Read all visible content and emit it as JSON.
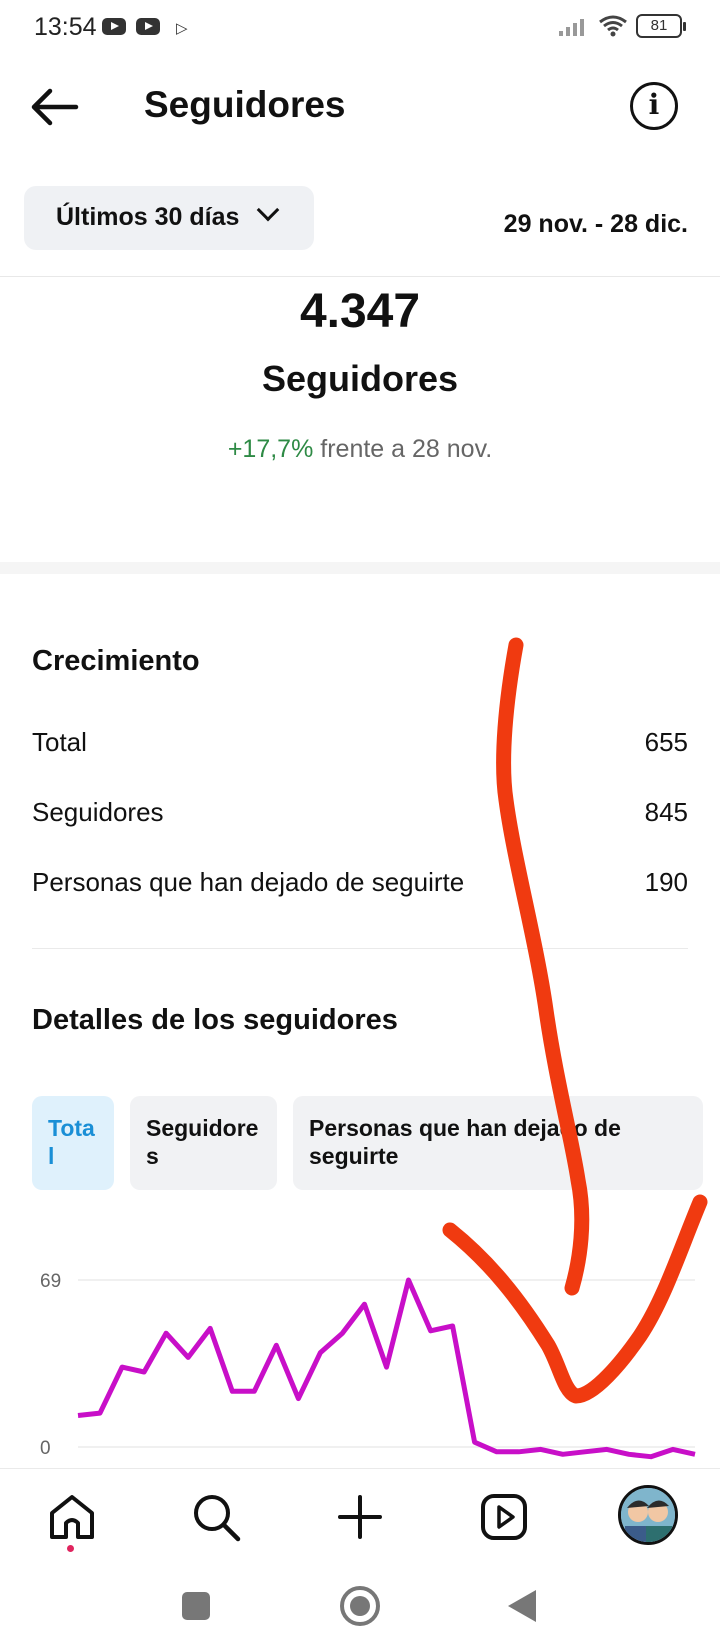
{
  "status_bar": {
    "time": "13:54",
    "battery": "81"
  },
  "header": {
    "title": "Seguidores"
  },
  "period": {
    "selected": "Últimos 30 días",
    "date_range": "29 nov. - 28 dic."
  },
  "summary": {
    "count": "4.347",
    "label": "Seguidores",
    "change_pct": "+17,7%",
    "change_text": "frente a 28 nov."
  },
  "growth": {
    "title": "Crecimiento",
    "rows": [
      {
        "label": "Total",
        "value": "655"
      },
      {
        "label": "Seguidores",
        "value": "845"
      },
      {
        "label": "Personas que han dejado de seguirte",
        "value": "190"
      }
    ]
  },
  "details": {
    "title": "Detalles de los seguidores",
    "tabs": [
      {
        "label": "Tota\nl",
        "active": true
      },
      {
        "label": "Seguidore\ns",
        "active": false
      },
      {
        "label": "Personas que han dejado de\nseguirte",
        "active": false
      }
    ]
  },
  "chart_data": {
    "type": "line",
    "ytick_labels": [
      "69",
      "0"
    ],
    "ylim": [
      0,
      69
    ],
    "grid": true,
    "color": "#c80fc8",
    "series": [
      {
        "values": [
          13,
          14,
          33,
          31,
          47,
          37,
          49,
          23,
          23,
          42,
          20,
          39,
          47,
          59,
          33,
          69,
          48,
          50,
          2,
          -2,
          -2,
          -1,
          -3,
          -2,
          -1,
          -3,
          -4,
          -1,
          -3
        ]
      }
    ]
  },
  "bottom_nav": {
    "items": [
      "home-icon",
      "search-icon",
      "create-icon",
      "reels-icon",
      "profile-avatar"
    ]
  },
  "colors": {
    "positive": "#2e8a45",
    "active_tab_bg": "#dff1fc",
    "active_tab_text": "#1a8fd6",
    "annotation": "#f03a10"
  }
}
